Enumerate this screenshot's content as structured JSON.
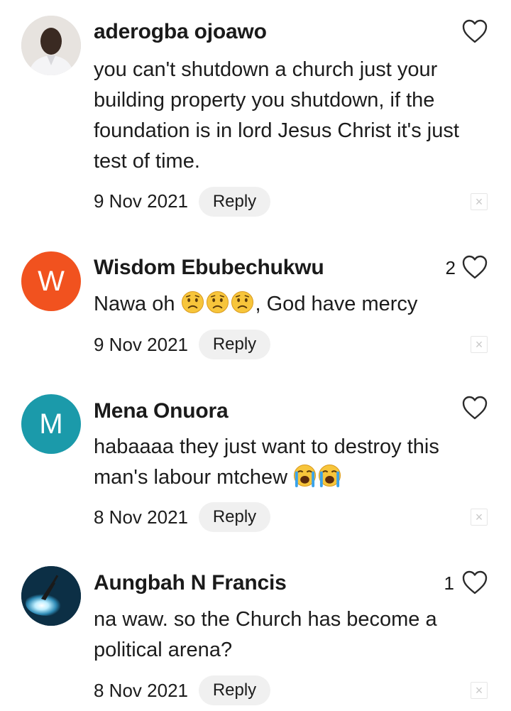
{
  "comments": [
    {
      "author": "aderogba ojoawo",
      "avatar_type": "photo",
      "body_lines": [
        "you can't shutdown a church just your",
        "building property you shutdown,  if the",
        "foundation is in lord Jesus Christ it's just",
        "test of time."
      ],
      "date": "9 Nov 2021",
      "reply_label": "Reply",
      "likes": "",
      "icon": "heart-outline-icon"
    },
    {
      "author": "Wisdom Ebubechukwu",
      "avatar_type": "letter",
      "avatar_letter": "W",
      "avatar_color": "#f1521f",
      "body_prefix": "Nawa oh ",
      "body_suffix": ", God have mercy",
      "emojis": [
        "worried-face-emoji",
        "worried-face-emoji",
        "worried-face-emoji"
      ],
      "date": "9 Nov 2021",
      "reply_label": "Reply",
      "likes": "2"
    },
    {
      "author": "Mena Onuora",
      "avatar_type": "letter",
      "avatar_letter": "M",
      "avatar_color": "#1b9aaa",
      "body_line1": "habaaaa they just want to destroy this",
      "body_line2_prefix": "man's labour mtchew ",
      "emojis": [
        "loudly-crying-face-emoji",
        "loudly-crying-face-emoji"
      ],
      "date": "8 Nov 2021",
      "reply_label": "Reply",
      "likes": ""
    },
    {
      "author": "Aungbah N Francis",
      "avatar_type": "image",
      "avatar_icon": "spotlight-avatar",
      "body_lines": [
        "na waw. so the Church has become a",
        "political arena?"
      ],
      "date": "8 Nov 2021",
      "reply_label": "Reply",
      "likes": "1"
    }
  ],
  "close_glyph": "×"
}
